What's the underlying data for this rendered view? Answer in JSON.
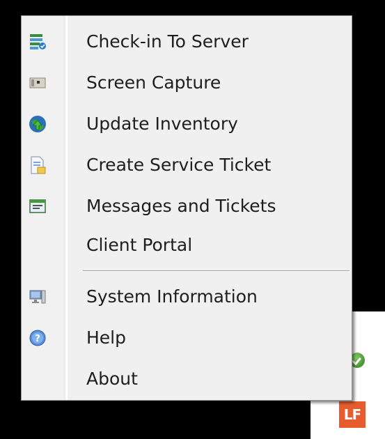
{
  "menu": {
    "items": [
      {
        "label": "Check-in To Server",
        "icon": "server-check-icon"
      },
      {
        "label": "Screen Capture",
        "icon": "camera-icon"
      },
      {
        "label": "Update Inventory",
        "icon": "globe-update-icon"
      },
      {
        "label": "Create Service Ticket",
        "icon": "ticket-document-icon"
      },
      {
        "label": "Messages and Tickets",
        "icon": "messages-icon"
      },
      {
        "label": "Client Portal",
        "icon": ""
      },
      {
        "label": "System Information",
        "icon": "computer-icon"
      },
      {
        "label": "Help",
        "icon": "help-icon"
      },
      {
        "label": "About",
        "icon": ""
      }
    ]
  },
  "tray": {
    "app_badge": "LF"
  },
  "colors": {
    "menu_background": "#f0f0f0",
    "menu_text": "#1e1e1e",
    "tray_badge": "#e65c2c",
    "status_ok": "#2f7a1d"
  }
}
